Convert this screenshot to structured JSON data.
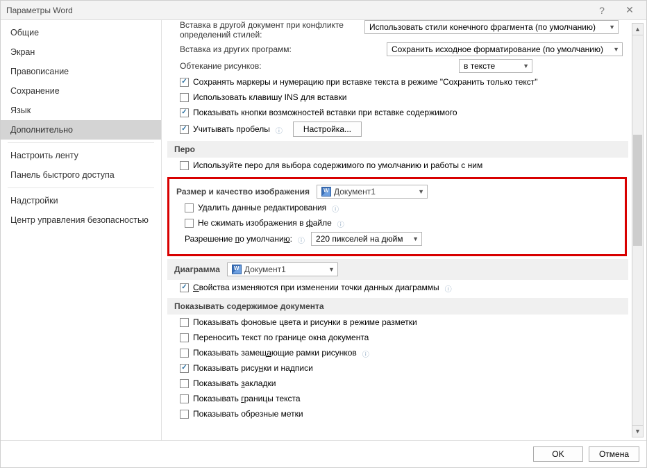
{
  "window": {
    "title": "Параметры Word",
    "help": "?",
    "close": "✕"
  },
  "sidebar": {
    "items": [
      "Общие",
      "Экран",
      "Правописание",
      "Сохранение",
      "Язык",
      "Дополнительно",
      "Настроить ленту",
      "Панель быстрого доступа",
      "Надстройки",
      "Центр управления безопасностью"
    ],
    "active_index": 5,
    "sep_after": [
      5,
      7
    ]
  },
  "top": {
    "insert_conflict_label": "Вставка в другой документ при конфликте определений стилей:",
    "insert_conflict_value": "Использовать стили конечного фрагмента (по умолчанию)",
    "insert_other_label": "Вставка из других программ:",
    "insert_other_value": "Сохранить исходное форматирование (по умолчанию)",
    "wrap_label": "Обтекание рисунков:",
    "wrap_value": "в тексте",
    "chk_bullets": "Сохранять маркеры и нумерацию при вставке текста в режиме \"Сохранить только текст\"",
    "chk_ins": "Использовать клавишу INS для вставки",
    "chk_paste_buttons": "Показывать кнопки возможностей вставки при вставке содержимого",
    "chk_spaces": "Учитывать пробелы",
    "settings_btn": "Настройка..."
  },
  "pen": {
    "head": "Перо",
    "chk_use_pen": "Используйте перо для выбора содержимого по умолчанию и работы с ним"
  },
  "image": {
    "head": "Размер и качество изображения",
    "doc_value": "Документ1",
    "chk_delete_edit": "Удалить данные редактирования",
    "chk_no_compress_pre": "Не сжимать изображения в ",
    "chk_no_compress_u": "ф",
    "chk_no_compress_post": "айле",
    "res_label_pre": "Разрешение ",
    "res_label_u": "п",
    "res_label_mid": "о умолчани",
    "res_label_u2": "ю",
    "res_label_post": ":",
    "res_value": "220 пикселей на дюйм"
  },
  "chart": {
    "head": "Диаграмма",
    "doc_value": "Документ1",
    "chk_props_pre": "",
    "chk_props_u": "С",
    "chk_props_post": "войства изменяются при изменении точки данных диаграммы"
  },
  "show": {
    "head": "Показывать содержимое документа",
    "chk_bg": "Показывать фоновые цвета и рисунки в режиме разметки",
    "chk_wrap": "Переносить текст по границе окна документа",
    "chk_placeholder_pre": "Показывать замещ",
    "chk_placeholder_u": "а",
    "chk_placeholder_post": "ющие рамки рисунков",
    "chk_pics_pre": "Показывать рису",
    "chk_pics_u": "н",
    "chk_pics_post": "ки и надписи",
    "chk_bookmarks_pre": "Показывать ",
    "chk_bookmarks_u": "з",
    "chk_bookmarks_post": "акладки",
    "chk_borders_pre": "Показывать ",
    "chk_borders_u": "г",
    "chk_borders_post": "раницы текста",
    "chk_crop": "Показывать обрезные метки"
  },
  "footer": {
    "ok": "OK",
    "cancel": "Отмена"
  }
}
